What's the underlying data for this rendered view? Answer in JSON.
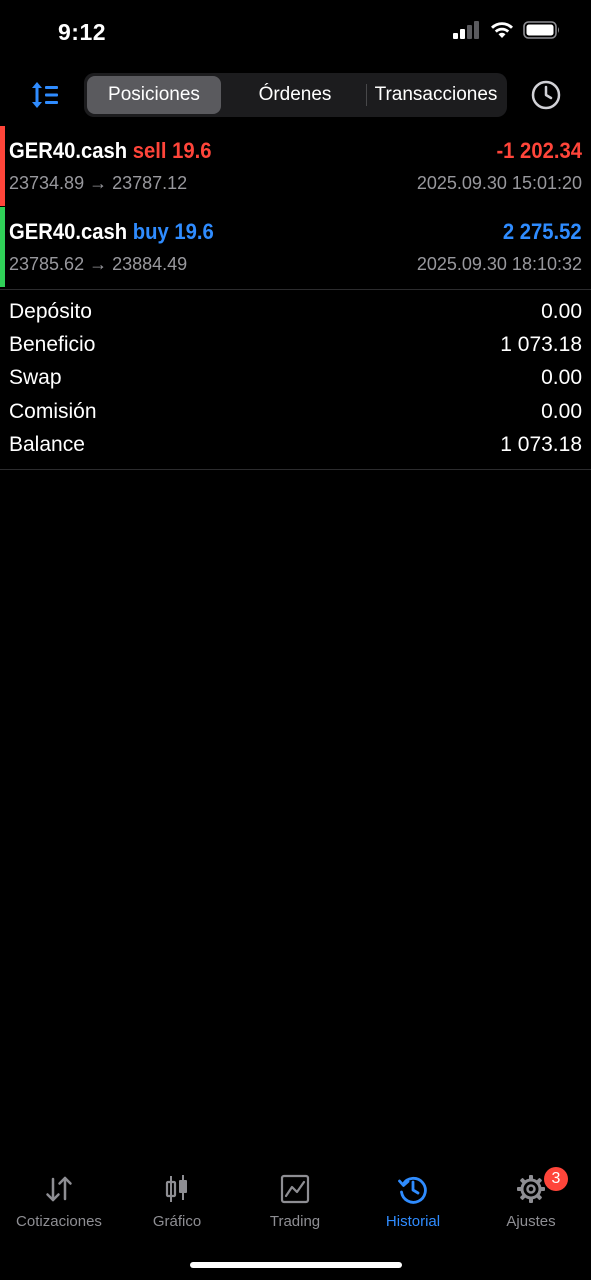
{
  "status_bar": {
    "time": "9:12"
  },
  "header": {
    "tabs": [
      {
        "label": "Posiciones",
        "active": true
      },
      {
        "label": "Órdenes",
        "active": false
      },
      {
        "label": "Transacciones",
        "active": false
      }
    ],
    "icons": {
      "sort": "sort-icon",
      "history": "clock-icon"
    }
  },
  "trades": [
    {
      "symbol": "GER40.cash",
      "side": "sell 19.6",
      "side_color": "#ff453a",
      "profit": "-1 202.34",
      "open_price": "23734.89",
      "close_price": "23787.12",
      "arrow": "→",
      "datetime": "2025.09.30 15:01:20"
    },
    {
      "symbol": "GER40.cash",
      "side": "buy 19.6",
      "side_color": "#2f8cff",
      "profit": "2 275.52",
      "open_price": "23785.62",
      "close_price": "23884.49",
      "arrow": "→",
      "datetime": "2025.09.30 18:10:32"
    }
  ],
  "summary": [
    {
      "label": "Depósito",
      "value": "0.00"
    },
    {
      "label": "Beneficio",
      "value": "1 073.18"
    },
    {
      "label": "Swap",
      "value": "0.00"
    },
    {
      "label": "Comisión",
      "value": "0.00"
    },
    {
      "label": "Balance",
      "value": "1 073.18"
    }
  ],
  "tabbar": [
    {
      "label": "Cotizaciones",
      "icon": "quotes-icon",
      "active": false
    },
    {
      "label": "Gráfico",
      "icon": "chart-icon",
      "active": false
    },
    {
      "label": "Trading",
      "icon": "trading-icon",
      "active": false
    },
    {
      "label": "Historial",
      "icon": "history-icon",
      "active": true
    },
    {
      "label": "Ajustes",
      "icon": "gear-icon",
      "active": false,
      "badge": "3"
    }
  ],
  "colors": {
    "accent": "#2f8cff",
    "loss": "#ff453a",
    "buy_bar": "#30d158",
    "sell_bar": "#ff453a"
  }
}
